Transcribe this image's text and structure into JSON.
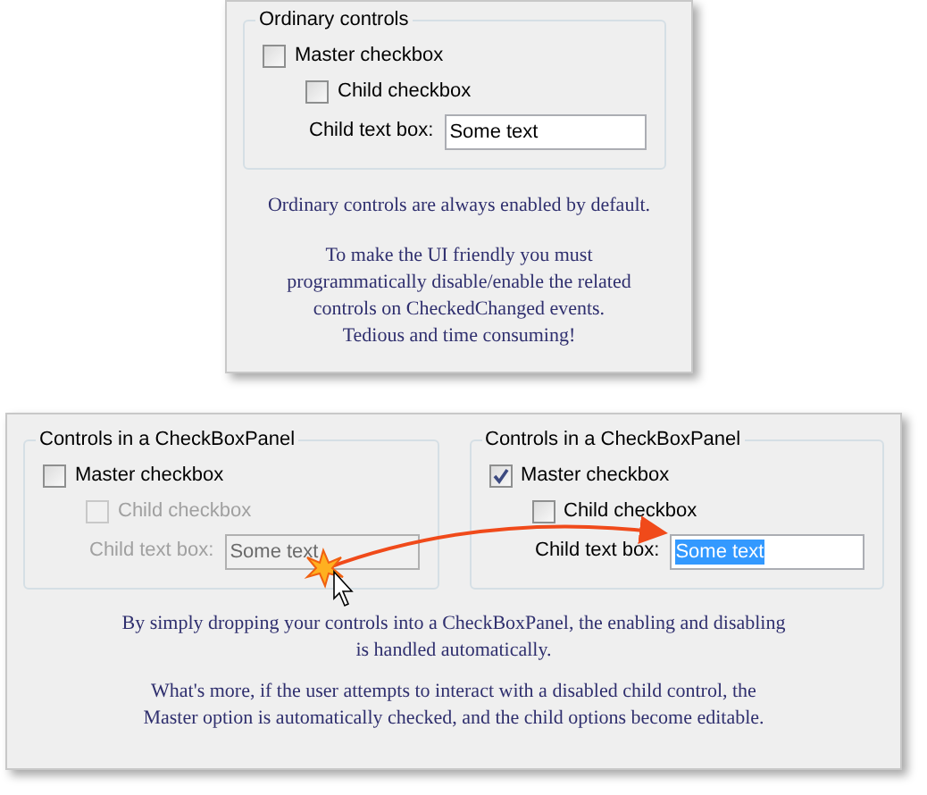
{
  "top_panel": {
    "group": {
      "title": "Ordinary controls",
      "master": {
        "label": "Master checkbox",
        "checked": false,
        "disabled": false
      },
      "child": {
        "label": "Child checkbox",
        "checked": false,
        "disabled": false
      },
      "text_box": {
        "label": "Child text box:",
        "value": "Some text",
        "disabled": false,
        "highlighted": false
      }
    },
    "paragraphs": [
      "Ordinary controls are always enabled by default.",
      "To make the UI friendly you must\nprogrammatically disable/enable the related\ncontrols on CheckedChanged events.\nTedious and time consuming!"
    ]
  },
  "bottom_panel": {
    "groups": [
      {
        "title": "Controls in a CheckBoxPanel",
        "master": {
          "label": "Master checkbox",
          "checked": false,
          "disabled": false
        },
        "child": {
          "label": "Child checkbox",
          "checked": false,
          "disabled": true
        },
        "text_box": {
          "label": "Child text box:",
          "value": "Some text",
          "disabled": true,
          "highlighted": false
        }
      },
      {
        "title": "Controls in a CheckBoxPanel",
        "master": {
          "label": "Master checkbox",
          "checked": true,
          "disabled": false
        },
        "child": {
          "label": "Child checkbox",
          "checked": false,
          "disabled": false
        },
        "text_box": {
          "label": "Child text box:",
          "value": "Some text",
          "disabled": false,
          "highlighted": true
        }
      }
    ],
    "paragraphs": [
      "By simply dropping your controls into a CheckBoxPanel, the enabling and disabling\nis handled automatically.",
      "What's more, if the user attempts to interact with a disabled child control, the\nMaster option is automatically checked, and the child options become editable."
    ]
  }
}
